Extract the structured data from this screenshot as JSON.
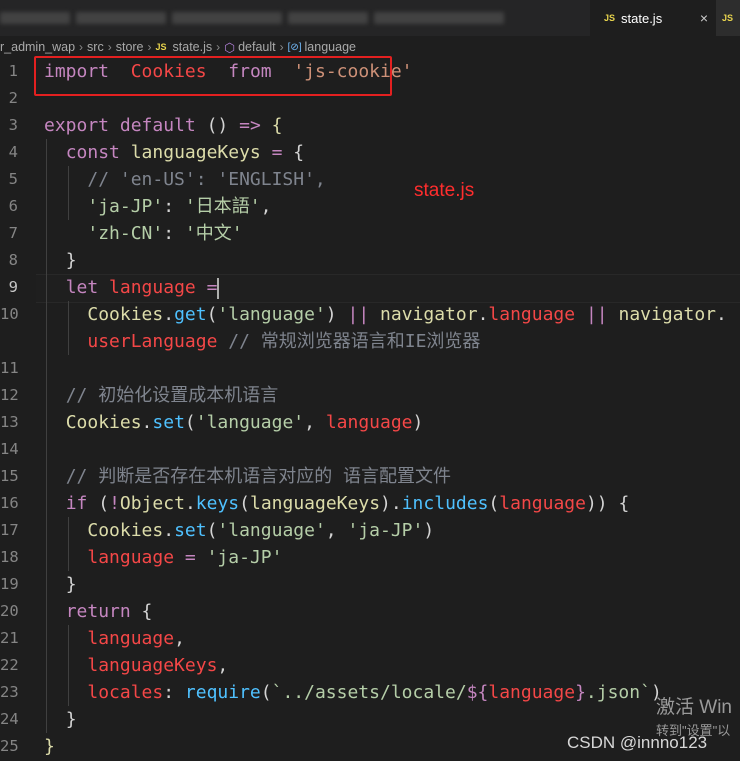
{
  "tabs": {
    "active": {
      "icon": "JS",
      "label": "state.js",
      "close": "×"
    },
    "next": {
      "icon": "JS",
      "label": "JS"
    }
  },
  "breadcrumb": {
    "items": [
      "r_admin_wap",
      "src",
      "store",
      "state.js",
      "default",
      "language"
    ],
    "file_icon": "JS"
  },
  "annotation": "state.js",
  "watermark": {
    "activate": "激活 Win",
    "goto": "转到\"设置\"以",
    "csdn": "CSDN @innno123"
  },
  "lines": [
    {
      "n": "1",
      "tokens": [
        [
          "t-imp",
          "import"
        ],
        [
          "",
          "  "
        ],
        [
          "t-red",
          "Cookies"
        ],
        [
          "",
          "  "
        ],
        [
          "t-imp",
          "from"
        ],
        [
          "",
          "  "
        ],
        [
          "t-str",
          "'js-cookie'"
        ]
      ]
    },
    {
      "n": "2",
      "tokens": []
    },
    {
      "n": "3",
      "tokens": [
        [
          "t-imp",
          "export"
        ],
        [
          "",
          " "
        ],
        [
          "t-imp",
          "default"
        ],
        [
          "",
          " "
        ],
        [
          "",
          "()"
        ],
        [
          "",
          " "
        ],
        [
          "t-imp",
          "=>"
        ],
        [
          "",
          " "
        ],
        [
          "t-yel",
          "{"
        ]
      ]
    },
    {
      "n": "4",
      "tokens": [
        [
          "",
          "  "
        ],
        [
          "t-imp",
          "const"
        ],
        [
          "",
          " "
        ],
        [
          "t-yel",
          "languageKeys"
        ],
        [
          "",
          " "
        ],
        [
          "t-imp",
          "="
        ],
        [
          "",
          " "
        ],
        [
          "",
          "{"
        ]
      ]
    },
    {
      "n": "5",
      "tokens": [
        [
          "",
          "    "
        ],
        [
          "t-gray",
          "// 'en-US': 'ENGLISH',"
        ]
      ]
    },
    {
      "n": "6",
      "tokens": [
        [
          "",
          "    "
        ],
        [
          "t-grn",
          "'ja-JP'"
        ],
        [
          "",
          ": "
        ],
        [
          "t-grn",
          "'日本語'"
        ],
        [
          "",
          ","
        ]
      ]
    },
    {
      "n": "7",
      "tokens": [
        [
          "",
          "    "
        ],
        [
          "t-grn",
          "'zh-CN'"
        ],
        [
          "",
          ": "
        ],
        [
          "t-grn",
          "'中文'"
        ]
      ]
    },
    {
      "n": "8",
      "tokens": [
        [
          "",
          "  "
        ],
        [
          "",
          "}"
        ]
      ]
    },
    {
      "n": "9",
      "tokens": [
        [
          "",
          "  "
        ],
        [
          "t-imp",
          "let"
        ],
        [
          "",
          " "
        ],
        [
          "t-red",
          "language"
        ],
        [
          "",
          " "
        ],
        [
          "t-imp",
          "="
        ]
      ]
    },
    {
      "n": "10",
      "tokens": [
        [
          "",
          "    "
        ],
        [
          "t-yel",
          "Cookies"
        ],
        [
          "",
          "."
        ],
        [
          "t-blue",
          "get"
        ],
        [
          "",
          "("
        ],
        [
          "t-grn",
          "'language'"
        ],
        [
          "",
          ") "
        ],
        [
          "t-imp",
          "||"
        ],
        [
          "",
          " "
        ],
        [
          "t-yel",
          "navigator"
        ],
        [
          "",
          "."
        ],
        [
          "t-red",
          "language"
        ],
        [
          "",
          " "
        ],
        [
          "t-imp",
          "||"
        ],
        [
          "",
          " "
        ],
        [
          "t-yel",
          "navigator"
        ],
        [
          "",
          "."
        ]
      ]
    },
    {
      "n": "",
      "tokens": [
        [
          "",
          "    "
        ],
        [
          "t-red",
          "userLanguage"
        ],
        [
          "",
          " "
        ],
        [
          "t-gray",
          "// 常规浏览器语言和IE浏览器"
        ]
      ]
    },
    {
      "n": "11",
      "tokens": []
    },
    {
      "n": "12",
      "tokens": [
        [
          "",
          "  "
        ],
        [
          "t-gray",
          "// 初始化设置成本机语言"
        ]
      ]
    },
    {
      "n": "13",
      "tokens": [
        [
          "",
          "  "
        ],
        [
          "t-yel",
          "Cookies"
        ],
        [
          "",
          "."
        ],
        [
          "t-blue",
          "set"
        ],
        [
          "",
          "("
        ],
        [
          "t-grn",
          "'language'"
        ],
        [
          "",
          ", "
        ],
        [
          "t-red",
          "language"
        ],
        [
          "",
          ")"
        ]
      ]
    },
    {
      "n": "14",
      "tokens": []
    },
    {
      "n": "15",
      "tokens": [
        [
          "",
          "  "
        ],
        [
          "t-gray",
          "// 判断是否存在本机语言对应的 语言配置文件"
        ]
      ]
    },
    {
      "n": "16",
      "tokens": [
        [
          "",
          "  "
        ],
        [
          "t-imp",
          "if"
        ],
        [
          "",
          " ("
        ],
        [
          "t-imp",
          "!"
        ],
        [
          "t-yel",
          "Object"
        ],
        [
          "",
          "."
        ],
        [
          "t-blue",
          "keys"
        ],
        [
          "",
          "("
        ],
        [
          "t-yel",
          "languageKeys"
        ],
        [
          "",
          ")."
        ],
        [
          "t-blue",
          "includes"
        ],
        [
          "",
          "("
        ],
        [
          "t-red",
          "language"
        ],
        [
          "",
          ")) {"
        ]
      ]
    },
    {
      "n": "17",
      "tokens": [
        [
          "",
          "    "
        ],
        [
          "t-yel",
          "Cookies"
        ],
        [
          "",
          "."
        ],
        [
          "t-blue",
          "set"
        ],
        [
          "",
          "("
        ],
        [
          "t-grn",
          "'language'"
        ],
        [
          "",
          ", "
        ],
        [
          "t-grn",
          "'ja-JP'"
        ],
        [
          "",
          ")"
        ]
      ]
    },
    {
      "n": "18",
      "tokens": [
        [
          "",
          "    "
        ],
        [
          "t-red",
          "language"
        ],
        [
          "",
          " "
        ],
        [
          "t-imp",
          "="
        ],
        [
          "",
          " "
        ],
        [
          "t-grn",
          "'ja-JP'"
        ]
      ]
    },
    {
      "n": "19",
      "tokens": [
        [
          "",
          "  "
        ],
        [
          "",
          "}"
        ]
      ]
    },
    {
      "n": "20",
      "tokens": [
        [
          "",
          "  "
        ],
        [
          "t-imp",
          "return"
        ],
        [
          "",
          " {"
        ]
      ]
    },
    {
      "n": "21",
      "tokens": [
        [
          "",
          "    "
        ],
        [
          "t-red",
          "language"
        ],
        [
          "",
          ","
        ]
      ]
    },
    {
      "n": "22",
      "tokens": [
        [
          "",
          "    "
        ],
        [
          "t-red",
          "languageKeys"
        ],
        [
          "",
          ","
        ]
      ]
    },
    {
      "n": "23",
      "tokens": [
        [
          "",
          "    "
        ],
        [
          "t-red",
          "locales"
        ],
        [
          "",
          ": "
        ],
        [
          "t-blue",
          "require"
        ],
        [
          "",
          "("
        ],
        [
          "t-grn",
          "`../assets/locale/"
        ],
        [
          "t-imp",
          "${"
        ],
        [
          "t-red",
          "language"
        ],
        [
          "t-imp",
          "}"
        ],
        [
          "t-grn",
          ".json`"
        ],
        [
          "",
          ")"
        ]
      ]
    },
    {
      "n": "24",
      "tokens": [
        [
          "",
          "  "
        ],
        [
          "",
          "}"
        ]
      ]
    },
    {
      "n": "25",
      "tokens": [
        [
          "t-yel",
          "}"
        ]
      ]
    }
  ]
}
